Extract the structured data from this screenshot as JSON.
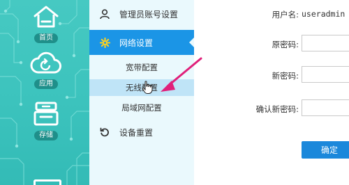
{
  "colors": {
    "rail_bg": "#3cc3bd",
    "menu_bg": "#eaf9fd",
    "active_bg": "#1b95e6",
    "selected_sub_bg": "#bfe4f7",
    "button_bg": "#1b88db",
    "annotation_arrow": "#e0207a"
  },
  "rail": {
    "items": [
      {
        "label": "首页",
        "icon": "home-icon"
      },
      {
        "label": "应用",
        "icon": "cloud-icon"
      },
      {
        "label": "存储",
        "icon": "storage-icon"
      }
    ]
  },
  "menu": {
    "items": [
      {
        "label": "管理员账号设置",
        "icon": "user-icon"
      },
      {
        "label": "网络设置",
        "icon": "gear-icon",
        "active": true
      },
      {
        "label": "设备重置",
        "icon": "reset-icon"
      }
    ],
    "sub_items": [
      {
        "label": "宽带配置"
      },
      {
        "label": "无线配置",
        "selected": true
      },
      {
        "label": "局域网配置"
      }
    ]
  },
  "form": {
    "username_label": "用户名:",
    "username_value": "useradmin",
    "old_password_label": "原密码:",
    "new_password_label": "新密码:",
    "confirm_password_label": "确认新密码:",
    "old_password_value": "",
    "new_password_value": "",
    "confirm_password_value": "",
    "confirm_button": "确定"
  }
}
